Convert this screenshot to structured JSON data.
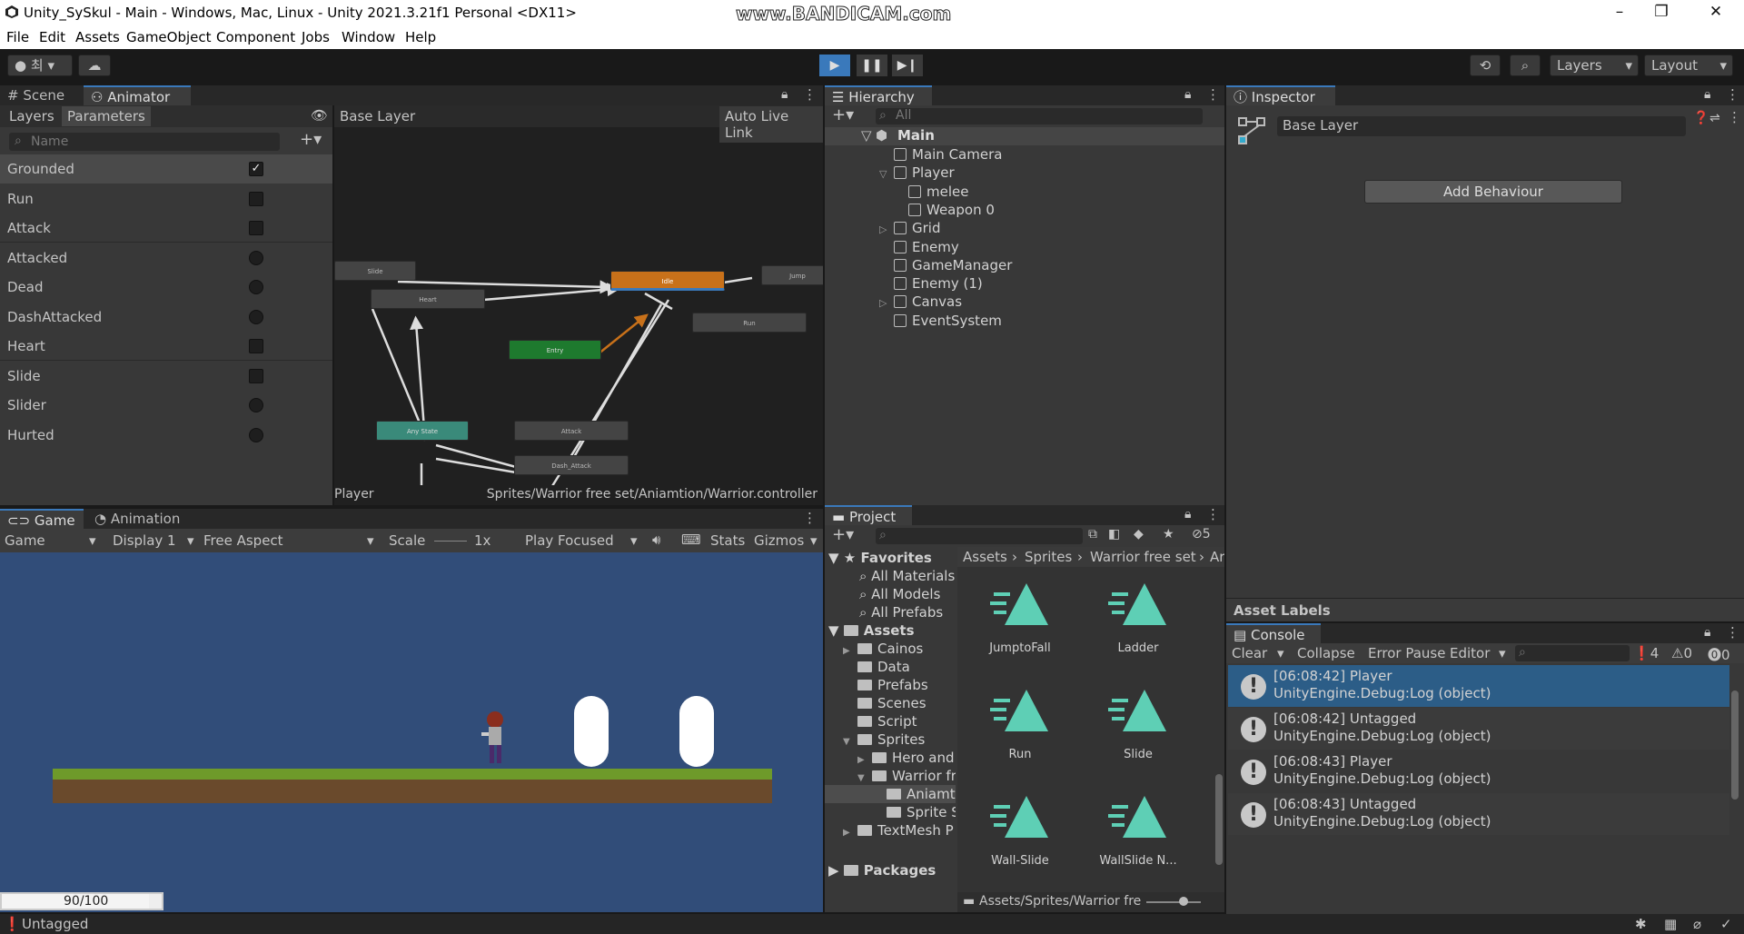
{
  "window": {
    "title": "Unity_SySkul - Main - Windows, Mac, Linux - Unity 2021.3.21f1 Personal <DX11>",
    "watermark": "www.BANDICAM.com"
  },
  "menu": [
    "File",
    "Edit",
    "Assets",
    "GameObject",
    "Component",
    "Jobs",
    "Window",
    "Help"
  ],
  "toolbar": {
    "account": "최",
    "layers": "Layers",
    "layout": "Layout"
  },
  "animator": {
    "tabs": [
      "Scene",
      "Animator"
    ],
    "subtabs": [
      "Layers",
      "Parameters"
    ],
    "breadcrumb": "Base Layer",
    "auto_live_link": "Auto Live Link",
    "search_placeholder": "Name",
    "params": [
      {
        "name": "Grounded",
        "type": "bool",
        "value": "checked"
      },
      {
        "name": "Run",
        "type": "bool",
        "value": "unchecked"
      },
      {
        "name": "Attack",
        "type": "bool",
        "value": "unchecked"
      },
      {
        "name": "Attacked",
        "type": "trigger",
        "value": "off"
      },
      {
        "name": "Dead",
        "type": "trigger",
        "value": "off"
      },
      {
        "name": "DashAttacked",
        "type": "trigger",
        "value": "off"
      },
      {
        "name": "Heart",
        "type": "bool",
        "value": "unchecked"
      },
      {
        "name": "Slide",
        "type": "bool",
        "value": "unchecked"
      },
      {
        "name": "Slider",
        "type": "trigger",
        "value": "off"
      },
      {
        "name": "Hurted",
        "type": "trigger",
        "value": "off"
      }
    ],
    "nodes": {
      "slide": "Slide",
      "heart": "Heart",
      "idle": "Idle",
      "jump": "Jump",
      "run": "Run",
      "entry": "Entry",
      "any": "Any State",
      "attack": "Attack",
      "dash": "Dash_Attack"
    },
    "footer_left": "Player",
    "footer_right": "Sprites/Warrior free set/Aniamtion/Warrior.controller"
  },
  "game": {
    "tabs": [
      "Game",
      "Animation"
    ],
    "bar": {
      "mode": "Game",
      "display": "Display 1",
      "aspect": "Free Aspect",
      "scale_label": "Scale",
      "scale_value": "1x",
      "play": "Play Focused",
      "stats": "Stats",
      "gizmos": "Gizmos"
    },
    "hp": "90/100"
  },
  "hierarchy": {
    "title": "Hierarchy",
    "search": "All",
    "scene": "Main",
    "items": [
      {
        "label": "Main Camera",
        "depth": 1,
        "arrow": ""
      },
      {
        "label": "Player",
        "depth": 1,
        "arrow": "▽"
      },
      {
        "label": "melee",
        "depth": 2,
        "arrow": ""
      },
      {
        "label": "Weapon 0",
        "depth": 2,
        "arrow": ""
      },
      {
        "label": "Grid",
        "depth": 1,
        "arrow": "▷"
      },
      {
        "label": "Enemy",
        "depth": 1,
        "arrow": ""
      },
      {
        "label": "GameManager",
        "depth": 1,
        "arrow": ""
      },
      {
        "label": "Enemy (1)",
        "depth": 1,
        "arrow": ""
      },
      {
        "label": "Canvas",
        "depth": 1,
        "arrow": "▷"
      },
      {
        "label": "EventSystem",
        "depth": 1,
        "arrow": ""
      }
    ]
  },
  "project": {
    "title": "Project",
    "hidden_count": "5",
    "favorites": "Favorites",
    "fav_items": [
      "All Materials",
      "All Models",
      "All Prefabs"
    ],
    "assets": "Assets",
    "folders": [
      {
        "label": "Cainos",
        "depth": 1,
        "arrow": "▶"
      },
      {
        "label": "Data",
        "depth": 1,
        "arrow": ""
      },
      {
        "label": "Prefabs",
        "depth": 1,
        "arrow": ""
      },
      {
        "label": "Scenes",
        "depth": 1,
        "arrow": ""
      },
      {
        "label": "Script",
        "depth": 1,
        "arrow": ""
      },
      {
        "label": "Sprites",
        "depth": 1,
        "arrow": "▼"
      },
      {
        "label": "Hero and",
        "depth": 2,
        "arrow": "▶"
      },
      {
        "label": "Warrior fr",
        "depth": 2,
        "arrow": "▼"
      },
      {
        "label": "Aniamti",
        "depth": 3,
        "arrow": ""
      },
      {
        "label": "Sprite S",
        "depth": 3,
        "arrow": ""
      },
      {
        "label": "TextMesh P",
        "depth": 1,
        "arrow": "▶"
      }
    ],
    "packages": "Packages",
    "breadcrumb": [
      "Assets",
      "Sprites",
      "Warrior free set",
      "Ar"
    ],
    "files": [
      "JumptoFall",
      "Ladder",
      "Run",
      "Slide",
      "Wall-Slide",
      "WallSlide N..."
    ],
    "footer_path": "Assets/Sprites/Warrior fre"
  },
  "inspector": {
    "title": "Inspector",
    "layer_name": "Base Layer",
    "add_behaviour": "Add Behaviour",
    "asset_labels": "Asset Labels"
  },
  "console": {
    "title": "Console",
    "bar": {
      "clear": "Clear",
      "collapse": "Collapse",
      "error_pause": "Error Pause",
      "editor": "Editor",
      "info_count": "4",
      "warn_count": "0",
      "error_count": "0"
    },
    "logs": [
      {
        "l1": "[06:08:42] Player",
        "l2": "UnityEngine.Debug:Log (object)"
      },
      {
        "l1": "[06:08:42] Untagged",
        "l2": "UnityEngine.Debug:Log (object)"
      },
      {
        "l1": "[06:08:43] Player",
        "l2": "UnityEngine.Debug:Log (object)"
      },
      {
        "l1": "[06:08:43] Untagged",
        "l2": "UnityEngine.Debug:Log (object)"
      }
    ]
  },
  "status": {
    "text": "Untagged"
  },
  "colors": {
    "accent": "#3a79bb",
    "panel": "#383838",
    "dark": "#191919",
    "game_bg": "#314d79",
    "idle_node": "#c8711a",
    "entry_node": "#1e7a2e",
    "any_node": "#3a8a7a",
    "asset_icon": "#5ecfb5"
  }
}
